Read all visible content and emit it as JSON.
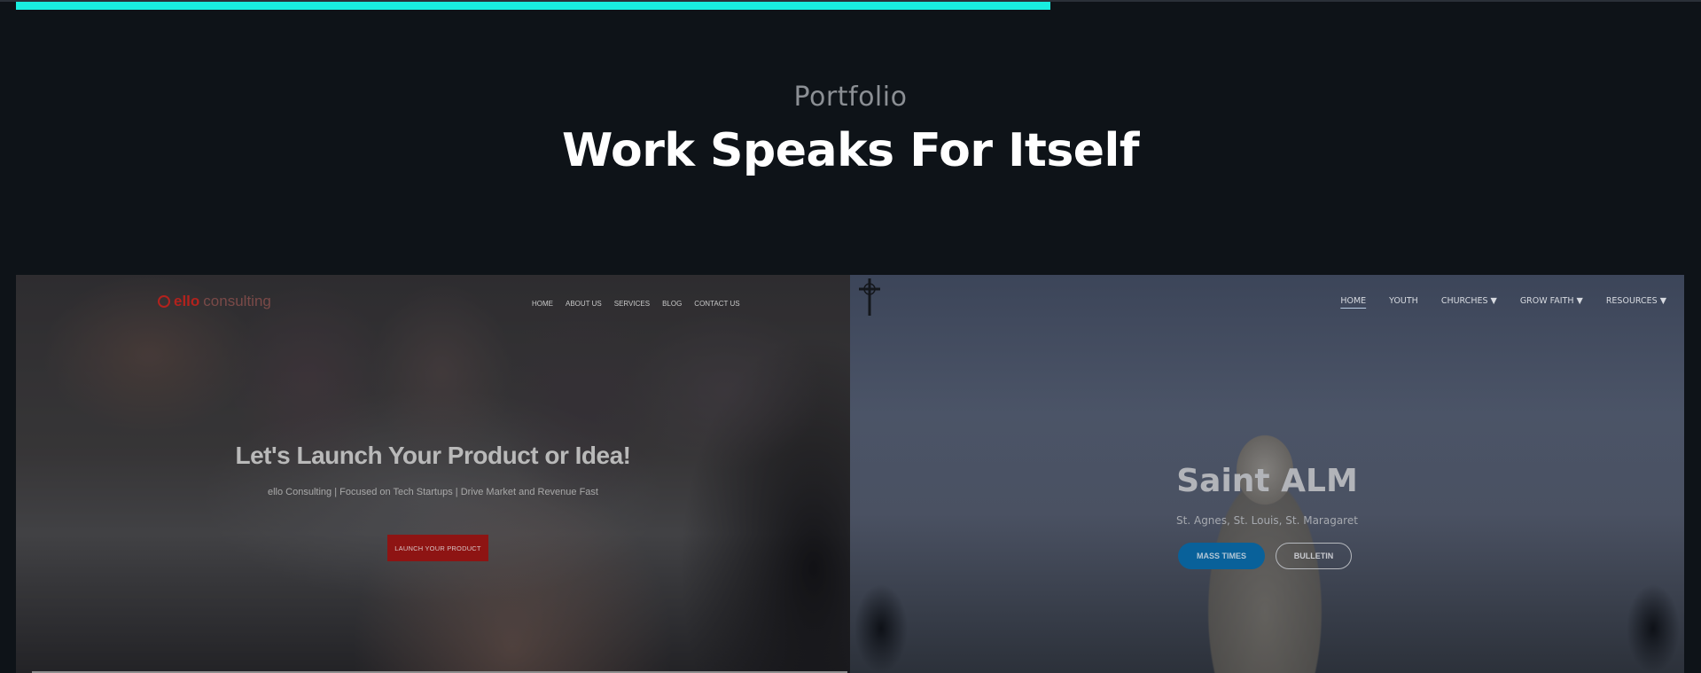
{
  "page": {
    "scroll_progress_percent": 62,
    "section_label": "Portfolio",
    "section_heading": "Work Speaks For Itself"
  },
  "portfolio": [
    {
      "logo_main": "ello",
      "logo_sub": "consulting",
      "nav": [
        "HOME",
        "ABOUT US",
        "SERVICES",
        "BLOG",
        "CONTACT US"
      ],
      "headline": "Let's Launch Your Product or Idea!",
      "tagline": "ello Consulting | Focused on Tech Startups | Drive Market and Revenue Fast",
      "cta": "LAUNCH YOUR PRODUCT"
    },
    {
      "nav": [
        "HOME",
        "YOUTH",
        "CHURCHES",
        "GROW FAITH",
        "RESOURCES"
      ],
      "nav_active": "HOME",
      "title": "Saint ALM",
      "subtitle": "St. Agnes, St. Louis, St. Maragaret",
      "buttons": [
        "MASS TIMES",
        "BULLETIN"
      ]
    }
  ],
  "colors": {
    "accent": "#19eee0",
    "background": "#0e1318",
    "ello_red": "#8e1413",
    "mass_blue": "#09619a"
  }
}
